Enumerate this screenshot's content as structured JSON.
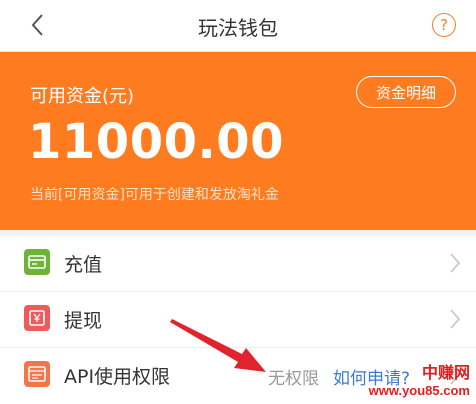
{
  "nav": {
    "title": "玩法钱包",
    "back_icon": "chevron-left-icon",
    "help_text": "?",
    "help_icon": "question-circle-icon"
  },
  "wallet": {
    "label": "可用资金(元)",
    "detail_button": "资金明细",
    "amount": "11000.00",
    "note": "当前[可用资金]可用于创建和发放淘礼金",
    "accent_color": "#ff7b1f"
  },
  "list": {
    "items": [
      {
        "label": "充值",
        "icon": "recharge-icon",
        "color": "#6fb23a"
      },
      {
        "label": "提现",
        "icon": "withdraw-icon",
        "color": "#ef5b5b"
      },
      {
        "label": "API使用权限",
        "icon": "api-icon",
        "color": "#f2764a",
        "status": "无权限",
        "link": "如何申请?"
      }
    ]
  },
  "annotation": {
    "arrow_color": "#e0242d"
  },
  "watermark": {
    "line1": "中赚网",
    "line2": "www.you85.com"
  }
}
